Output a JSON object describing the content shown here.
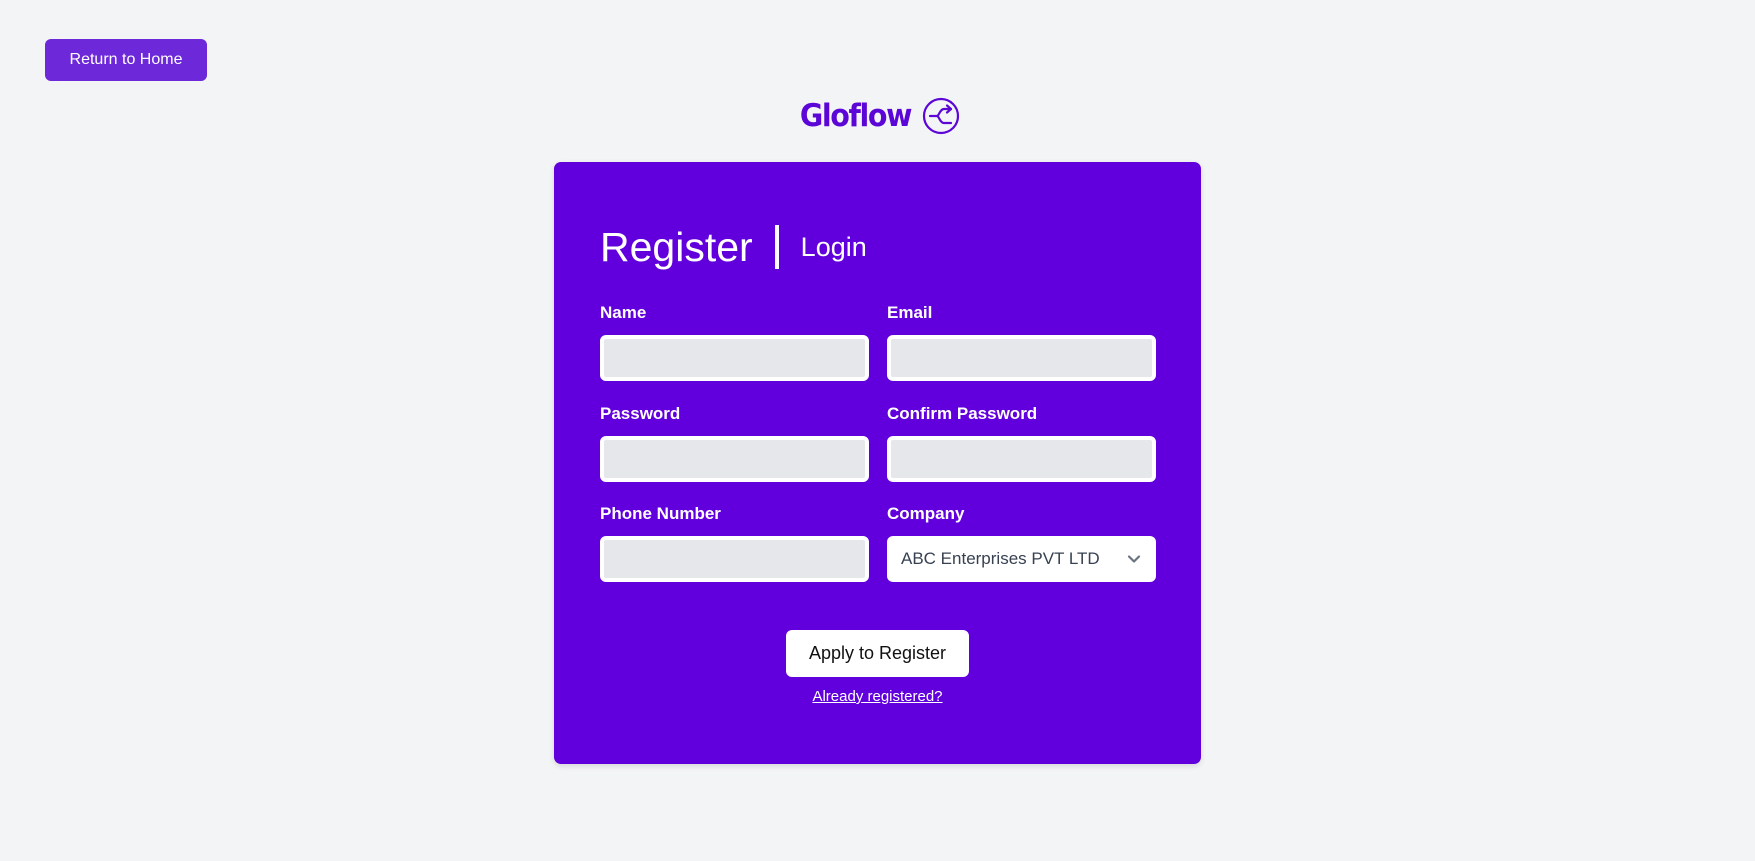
{
  "nav": {
    "home_label": "Return to Home"
  },
  "brand": {
    "name": "Gloflow",
    "icon": "share-flow-icon",
    "color": "#5b06d6"
  },
  "colors": {
    "background": "#f3f4f6",
    "card": "#6200dd",
    "accent_button": "#6d28d9",
    "input_fill": "#e5e7eb"
  },
  "tabs": {
    "register_label": "Register",
    "login_label": "Login"
  },
  "form": {
    "name": {
      "label": "Name",
      "value": ""
    },
    "email": {
      "label": "Email",
      "value": ""
    },
    "password": {
      "label": "Password",
      "value": ""
    },
    "confirm_password": {
      "label": "Confirm Password",
      "value": ""
    },
    "phone": {
      "label": "Phone Number",
      "value": ""
    },
    "company": {
      "label": "Company",
      "selected": "ABC Enterprises PVT LTD",
      "icon": "chevron-down-icon"
    }
  },
  "actions": {
    "submit_label": "Apply to Register",
    "already_registered_label": "Already registered?"
  }
}
